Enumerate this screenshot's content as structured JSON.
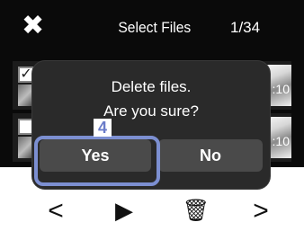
{
  "header": {
    "close_icon": "close-icon",
    "title": "Select Files",
    "counter": "1/34"
  },
  "file_list": {
    "rows": [
      {
        "checked": true,
        "duration": ":10"
      },
      {
        "checked": false,
        "duration": ":10"
      }
    ]
  },
  "dialog": {
    "line1": "Delete files.",
    "line2": "Are you sure?",
    "yes_label": "Yes",
    "no_label": "No"
  },
  "annotation": {
    "step_number": "4",
    "highlight_color": "#7c8fd1"
  },
  "toolbar": {
    "prev_label": "<",
    "play_icon": "play-icon",
    "delete_icon": "trash-icon",
    "next_label": ">"
  },
  "colors": {
    "screen_background": "#0a0a0a",
    "dialog_background": "#2a2a2a",
    "button_background": "#4a4a4a"
  }
}
